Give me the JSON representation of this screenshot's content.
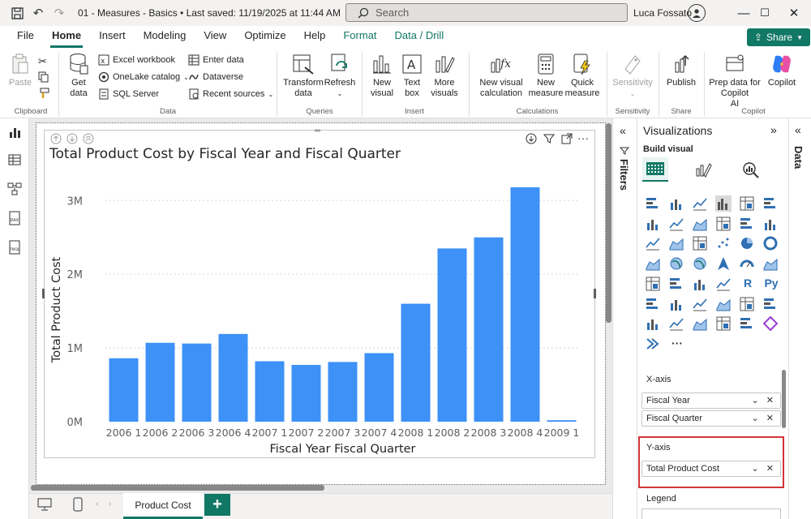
{
  "titlebar": {
    "title": "01 - Measures - Basics • Last saved: 11/19/2025 at 11:44 AM",
    "search_placeholder": "Search",
    "user_name": "Luca Fossato"
  },
  "ribbon_tabs": [
    "File",
    "Home",
    "Insert",
    "Modeling",
    "View",
    "Optimize",
    "Help",
    "Format",
    "Data / Drill"
  ],
  "share_label": "Share",
  "ribbon": {
    "clipboard": {
      "paste": "Paste",
      "group": "Clipboard"
    },
    "data": {
      "get_data": "Get data",
      "excel": "Excel workbook",
      "onelake": "OneLake catalog",
      "sql": "SQL Server",
      "enter_data": "Enter data",
      "dataverse": "Dataverse",
      "recent": "Recent sources",
      "group": "Data"
    },
    "queries": {
      "transform": "Transform data",
      "refresh": "Refresh",
      "group": "Queries"
    },
    "insert": {
      "new_visual": "New visual",
      "text_box": "Text box",
      "more_visuals": "More visuals",
      "group": "Insert"
    },
    "calculations": {
      "new_visual_calc": "New visual calculation",
      "new_measure": "New measure",
      "quick_measure": "Quick measure",
      "group": "Calculations"
    },
    "sensitivity": {
      "label": "Sensitivity",
      "group": "Sensitivity"
    },
    "share": {
      "publish": "Publish",
      "group": "Share"
    },
    "copilot": {
      "prep": "Prep data for Copilot",
      "ai": "AI",
      "copilot": "Copilot",
      "group": "Copilot"
    }
  },
  "chart_data": {
    "type": "bar",
    "title": "Total Product Cost by Fiscal Year and Fiscal Quarter",
    "xlabel": "Fiscal Year Fiscal Quarter",
    "ylabel": "Total Product Cost",
    "categories": [
      "2006 1",
      "2006 2",
      "2006 3",
      "2006 4",
      "2007 1",
      "2007 2",
      "2007 3",
      "2007 4",
      "2008 1",
      "2008 2",
      "2008 3",
      "2008 4",
      "2009 1"
    ],
    "values": [
      860000,
      1070000,
      1060000,
      1190000,
      820000,
      770000,
      810000,
      930000,
      1600000,
      2350000,
      2500000,
      3180000,
      20000
    ],
    "ylim": [
      0,
      3300000
    ],
    "yticks": [
      0,
      1000000,
      2000000,
      3000000
    ],
    "ytick_labels": [
      "0M",
      "1M",
      "2M",
      "3M"
    ],
    "grid": true,
    "bar_color": "#3d91f7"
  },
  "page_tab": "Product Cost",
  "filters_label": "Filters",
  "data_label": "Data",
  "viz": {
    "title": "Visualizations",
    "build_visual": "Build visual",
    "xaxis_label": "X-axis",
    "xaxis_fields": [
      "Fiscal Year",
      "Fiscal Quarter"
    ],
    "yaxis_label": "Y-axis",
    "yaxis_fields": [
      "Total Product Cost"
    ],
    "legend_label": "Legend",
    "r_label": "R",
    "py_label": "Py",
    "more": "···"
  }
}
